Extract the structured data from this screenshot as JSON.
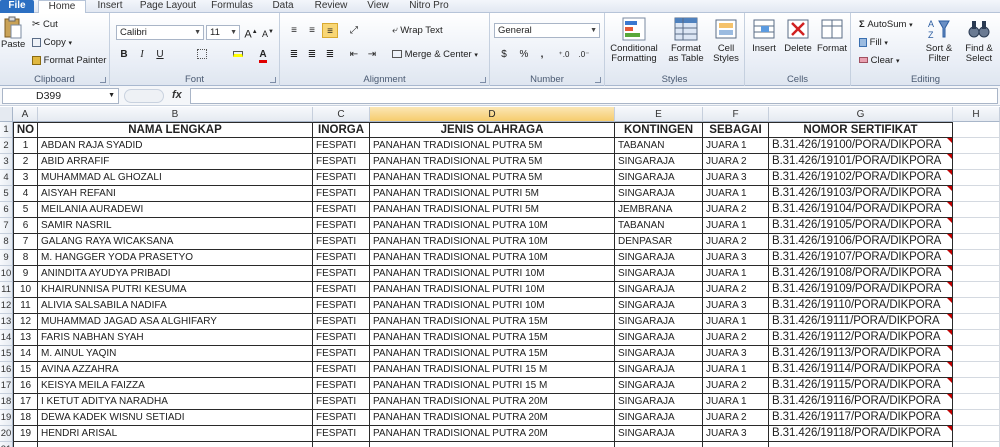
{
  "tabs": [
    "File",
    "Home",
    "Insert",
    "Page Layout",
    "Formulas",
    "Data",
    "Review",
    "View",
    "Nitro Pro"
  ],
  "ribbon": {
    "clipboard": {
      "paste": "Paste",
      "cut": "Cut",
      "copy": "Copy",
      "format_painter": "Format Painter",
      "label": "Clipboard"
    },
    "font": {
      "name": "Calibri",
      "size": "11",
      "bold": "B",
      "italic": "I",
      "underline": "U",
      "label": "Font"
    },
    "alignment": {
      "wrap": "Wrap Text",
      "merge": "Merge & Center",
      "label": "Alignment"
    },
    "number": {
      "format": "General",
      "currency": "$",
      "percent": "%",
      "comma": ",",
      "label": "Number"
    },
    "styles": {
      "conditional": "Conditional Formatting",
      "format_table": "Format as Table",
      "cell_styles": "Cell Styles",
      "label": "Styles"
    },
    "cells": {
      "insert": "Insert",
      "delete": "Delete",
      "format": "Format",
      "label": "Cells"
    },
    "editing": {
      "autosum": "AutoSum",
      "fill": "Fill",
      "clear": "Clear",
      "sort": "Sort & Filter",
      "find": "Find & Select",
      "label": "Editing"
    }
  },
  "formula_bar": {
    "name_box": "D399",
    "fx": "fx",
    "value": ""
  },
  "columns": [
    "A",
    "B",
    "C",
    "D",
    "E",
    "F",
    "G",
    "H"
  ],
  "selected_column": "D",
  "header_row": [
    "NO",
    "NAMA LENGKAP",
    "INORGA",
    "JENIS OLAHRAGA",
    "KONTINGEN",
    "SEBAGAI",
    "NOMOR SERTIFIKAT"
  ],
  "rows": [
    [
      "1",
      "ABDAN RAJA SYADID",
      "FESPATI",
      "PANAHAN TRADISIONAL PUTRA 5M",
      "TABANAN",
      "JUARA 1",
      "B.31.426/19100/PORA/DIKPORA"
    ],
    [
      "2",
      "ABID ARRAFIF",
      "FESPATI",
      "PANAHAN TRADISIONAL PUTRA 5M",
      "SINGARAJA",
      "JUARA 2",
      "B.31.426/19101/PORA/DIKPORA"
    ],
    [
      "3",
      "MUHAMMAD AL GHOZALI",
      "FESPATI",
      "PANAHAN TRADISIONAL PUTRA 5M",
      "SINGARAJA",
      "JUARA 3",
      "B.31.426/19102/PORA/DIKPORA"
    ],
    [
      "4",
      "AISYAH REFANI",
      "FESPATI",
      "PANAHAN TRADISIONAL PUTRI 5M",
      "SINGARAJA",
      "JUARA 1",
      "B.31.426/19103/PORA/DIKPORA"
    ],
    [
      "5",
      "MEILANIA AURADEWI",
      "FESPATI",
      "PANAHAN TRADISIONAL PUTRI 5M",
      "JEMBRANA",
      "JUARA 2",
      "B.31.426/19104/PORA/DIKPORA"
    ],
    [
      "6",
      "SAMIR NASRIL",
      "FESPATI",
      "PANAHAN TRADISIONAL PUTRA 10M",
      "TABANAN",
      "JUARA 1",
      "B.31.426/19105/PORA/DIKPORA"
    ],
    [
      "7",
      "GALANG RAYA WICAKSANA",
      "FESPATI",
      "PANAHAN TRADISIONAL PUTRA 10M",
      "DENPASAR",
      "JUARA 2",
      "B.31.426/19106/PORA/DIKPORA"
    ],
    [
      "8",
      "M. HANGGER YODA PRASETYO",
      "FESPATI",
      "PANAHAN TRADISIONAL PUTRA 10M",
      "SINGARAJA",
      "JUARA 3",
      "B.31.426/19107/PORA/DIKPORA"
    ],
    [
      "9",
      "ANINDITA AYUDYA PRIBADI",
      "FESPATI",
      "PANAHAN TRADISIONAL PUTRI 10M",
      "SINGARAJA",
      "JUARA 1",
      "B.31.426/19108/PORA/DIKPORA"
    ],
    [
      "10",
      "KHAIRUNNISA PUTRI KESUMA",
      "FESPATI",
      "PANAHAN TRADISIONAL PUTRI 10M",
      "SINGARAJA",
      "JUARA 2",
      "B.31.426/19109/PORA/DIKPORA"
    ],
    [
      "11",
      "ALIVIA SALSABILA NADIFA",
      "FESPATI",
      "PANAHAN TRADISIONAL PUTRI 10M",
      "SINGARAJA",
      "JUARA 3",
      "B.31.426/19110/PORA/DIKPORA"
    ],
    [
      "12",
      "MUHAMMAD JAGAD ASA ALGHIFARY",
      "FESPATI",
      "PANAHAN TRADISIONAL PUTRA 15M",
      "SINGARAJA",
      "JUARA 1",
      "B.31.426/19111/PORA/DIKPORA"
    ],
    [
      "13",
      "FARIS NABHAN SYAH",
      "FESPATI",
      "PANAHAN TRADISIONAL PUTRA 15M",
      "SINGARAJA",
      "JUARA 2",
      "B.31.426/19112/PORA/DIKPORA"
    ],
    [
      "14",
      "M. AINUL YAQIN",
      "FESPATI",
      "PANAHAN TRADISIONAL PUTRA 15M",
      "SINGARAJA",
      "JUARA 3",
      "B.31.426/19113/PORA/DIKPORA"
    ],
    [
      "15",
      "AVINA AZZAHRA",
      "FESPATI",
      "PANAHAN TRADISIONAL PUTRI 15 M",
      "SINGARAJA",
      "JUARA 1",
      "B.31.426/19114/PORA/DIKPORA"
    ],
    [
      "16",
      "KEISYA MEILA FAIZZA",
      "FESPATI",
      "PANAHAN TRADISIONAL PUTRI 15 M",
      "SINGARAJA",
      "JUARA 2",
      "B.31.426/19115/PORA/DIKPORA"
    ],
    [
      "17",
      "I KETUT ADITYA NARADHA",
      "FESPATI",
      "PANAHAN TRADISIONAL PUTRA 20M",
      "SINGARAJA",
      "JUARA 1",
      "B.31.426/19116/PORA/DIKPORA"
    ],
    [
      "18",
      "DEWA KADEK WISNU SETIADI",
      "FESPATI",
      "PANAHAN TRADISIONAL PUTRA 20M",
      "SINGARAJA",
      "JUARA 2",
      "B.31.426/19117/PORA/DIKPORA"
    ],
    [
      "19",
      "HENDRI ARISAL",
      "FESPATI",
      "PANAHAN TRADISIONAL PUTRA 20M",
      "SINGARAJA",
      "JUARA 3",
      "B.31.426/19118/PORA/DIKPORA"
    ]
  ]
}
